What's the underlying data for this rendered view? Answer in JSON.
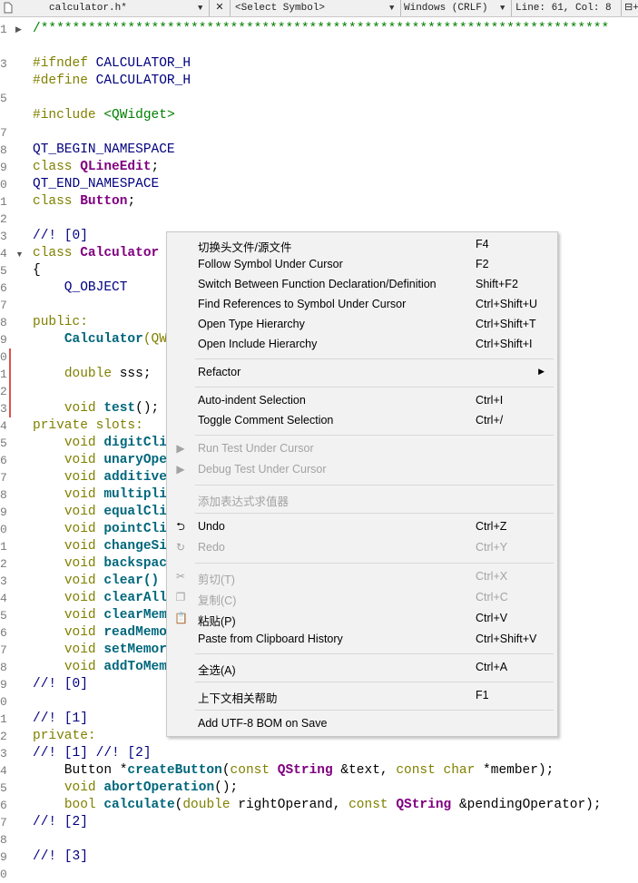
{
  "toolbar": {
    "file_name": "calculator.h*",
    "symbol": "<Select Symbol>",
    "line_ending": "Windows (CRLF)",
    "position": "Line: 61, Col: 8",
    "close_glyph": "✕",
    "split_glyph": "⊟+"
  },
  "gutter": [
    "1",
    "",
    "3",
    "",
    "5",
    "",
    "7",
    "8",
    "9",
    "0",
    "1",
    "2",
    "3",
    "4",
    "5",
    "6",
    "7",
    "8",
    "9",
    "0",
    "1",
    "2",
    "3",
    "4",
    "5",
    "6",
    "7",
    "8",
    "9",
    "0",
    "1",
    "2",
    "3",
    "4",
    "5",
    "6",
    "7",
    "8",
    "9",
    "0",
    "1",
    "2",
    "3",
    "4",
    "5",
    "6",
    "7",
    "8",
    "9",
    "0"
  ],
  "code": {
    "l1": "/************************************************************************",
    "l3a": "#ifndef",
    "l3b": " CALCULATOR_H",
    "l4a": "#define",
    "l4b": " CALCULATOR_H",
    "l6a": "#include",
    "l6b": " <QWidget>",
    "l8": "QT_BEGIN_NAMESPACE",
    "l9a": "class",
    "l9b": " QLineEdit",
    "l9c": ";",
    "l10": "QT_END_NAMESPACE",
    "l11a": "class",
    "l11b": " Button",
    "l11c": ";",
    "l13": "//! [0]",
    "l14a": "class",
    "l14b": " Calculator",
    "l15": "{",
    "l16": "    Q_OBJECT",
    "l18": "public:",
    "l19a": "    ",
    "l19b": "Calculator",
    "l19c": "(QW",
    "l21a": "    ",
    "l21b": "double",
    "l21c": " sss;",
    "l23a": "    ",
    "l23b": "void",
    "l23c": " ",
    "l23d": "test",
    "l23e": "();",
    "l24": "private slots:",
    "slots": [
      {
        "pre": "    ",
        "kw": "void",
        "name": " digitCli"
      },
      {
        "pre": "    ",
        "kw": "void",
        "name": " unaryOpe"
      },
      {
        "pre": "    ",
        "kw": "void",
        "name": " additive"
      },
      {
        "pre": "    ",
        "kw": "void",
        "name": " multipli"
      },
      {
        "pre": "    ",
        "kw": "void",
        "name": " equalCli"
      },
      {
        "pre": "    ",
        "kw": "void",
        "name": " pointCli"
      },
      {
        "pre": "    ",
        "kw": "void",
        "name": " changeSi"
      },
      {
        "pre": "    ",
        "kw": "void",
        "name": " backspac"
      },
      {
        "pre": "    ",
        "kw": "void",
        "name": " clear()"
      },
      {
        "pre": "    ",
        "kw": "void",
        "name": " clearAll"
      },
      {
        "pre": "    ",
        "kw": "void",
        "name": " clearMem"
      },
      {
        "pre": "    ",
        "kw": "void",
        "name": " readMemo"
      },
      {
        "pre": "    ",
        "kw": "void",
        "name": " setMemor"
      },
      {
        "pre": "    ",
        "kw": "void",
        "name": " addToMem"
      }
    ],
    "l39": "//! [0]",
    "l41": "//! [1]",
    "l42": "private:",
    "l43": "//! [1] //! [2]",
    "l44": [
      {
        "t": "    Button ",
        "c": ""
      },
      {
        "t": "*",
        "c": ""
      },
      {
        "t": "createButton",
        "c": "fnb"
      },
      {
        "t": "(",
        "c": ""
      },
      {
        "t": "const",
        "c": "kw"
      },
      {
        "t": " QString",
        "c": "cls2"
      },
      {
        "t": " &text, ",
        "c": ""
      },
      {
        "t": "const",
        "c": "kw"
      },
      {
        "t": " char",
        "c": "kw"
      },
      {
        "t": " *member);",
        "c": ""
      }
    ],
    "l45": [
      {
        "t": "    ",
        "c": ""
      },
      {
        "t": "void",
        "c": "kw"
      },
      {
        "t": " ",
        "c": ""
      },
      {
        "t": "abortOperation",
        "c": "fnb"
      },
      {
        "t": "();",
        "c": ""
      }
    ],
    "l46": [
      {
        "t": "    ",
        "c": ""
      },
      {
        "t": "bool",
        "c": "kw"
      },
      {
        "t": " ",
        "c": ""
      },
      {
        "t": "calculate",
        "c": "fnb"
      },
      {
        "t": "(",
        "c": ""
      },
      {
        "t": "double",
        "c": "kw"
      },
      {
        "t": " rightOperand, ",
        "c": ""
      },
      {
        "t": "const",
        "c": "kw"
      },
      {
        "t": " QString",
        "c": "cls2"
      },
      {
        "t": " &pendingOperator);",
        "c": ""
      }
    ],
    "l47": "//! [2]",
    "l49": "//! [3]"
  },
  "menu": {
    "items": [
      {
        "label": "切换头文件/源文件",
        "shortcut": "F4",
        "disabled": false
      },
      {
        "label": "Follow Symbol Under Cursor",
        "shortcut": "F2",
        "disabled": false
      },
      {
        "label": "Switch Between Function Declaration/Definition",
        "shortcut": "Shift+F2",
        "disabled": false
      },
      {
        "label": "Find References to Symbol Under Cursor",
        "shortcut": "Ctrl+Shift+U",
        "disabled": false
      },
      {
        "label": "Open Type Hierarchy",
        "shortcut": "Ctrl+Shift+T",
        "disabled": false
      },
      {
        "label": "Open Include Hierarchy",
        "shortcut": "Ctrl+Shift+I",
        "disabled": false
      },
      {
        "label": "Refactor",
        "shortcut": "",
        "disabled": false
      },
      {
        "label": "Auto-indent Selection",
        "shortcut": "Ctrl+I",
        "disabled": false
      },
      {
        "label": "Toggle Comment Selection",
        "shortcut": "Ctrl+/",
        "disabled": false
      },
      {
        "label": "Run Test Under Cursor",
        "shortcut": "",
        "disabled": true
      },
      {
        "label": "Debug Test Under Cursor",
        "shortcut": "",
        "disabled": true
      },
      {
        "label": "添加表达式求值器",
        "shortcut": "",
        "disabled": true
      },
      {
        "label": "Undo",
        "shortcut": "Ctrl+Z",
        "disabled": false
      },
      {
        "label": "Redo",
        "shortcut": "Ctrl+Y",
        "disabled": true
      },
      {
        "label": "剪切(T)",
        "shortcut": "Ctrl+X",
        "disabled": true
      },
      {
        "label": "复制(C)",
        "shortcut": "Ctrl+C",
        "disabled": true
      },
      {
        "label": "粘贴(P)",
        "shortcut": "Ctrl+V",
        "disabled": false
      },
      {
        "label": "Paste from Clipboard History",
        "shortcut": "Ctrl+Shift+V",
        "disabled": false
      },
      {
        "label": "全选(A)",
        "shortcut": "Ctrl+A",
        "disabled": false
      },
      {
        "label": "上下文相关帮助",
        "shortcut": "F1",
        "disabled": false
      },
      {
        "label": "Add UTF-8 BOM on Save",
        "shortcut": "",
        "disabled": false
      }
    ]
  },
  "colors": {
    "keyword": "#808000",
    "type": "#800080",
    "function": "#00677c",
    "comment": "#000080",
    "string": "#008000",
    "menu_bg": "#f2f2f2",
    "disabled": "#a3a3a3",
    "change_marker": "#e05050"
  }
}
